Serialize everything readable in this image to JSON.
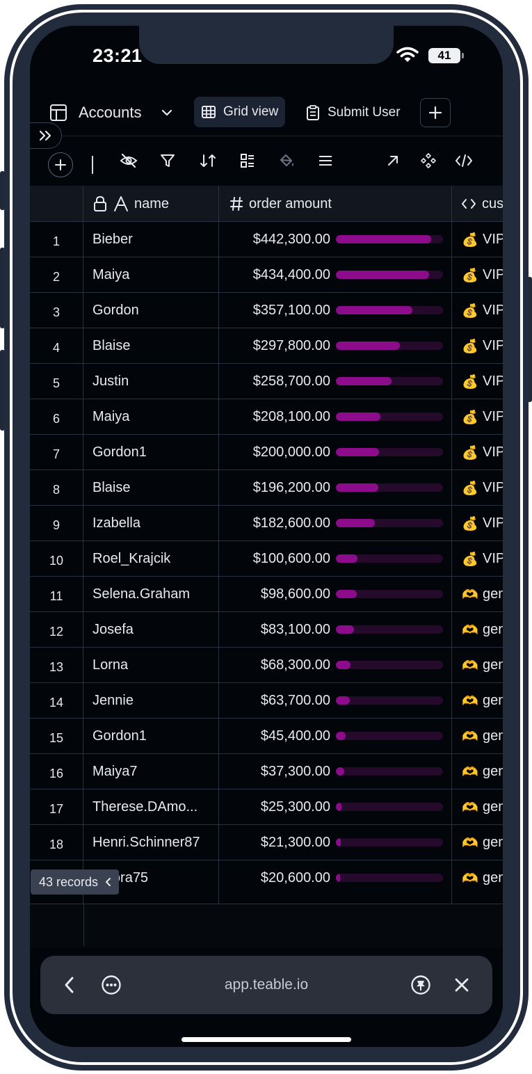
{
  "status_bar": {
    "time": "23:21",
    "battery": "41"
  },
  "topbar": {
    "table_name": "Accounts",
    "grid_view_label": "Grid view",
    "submit_view_label": "Submit User"
  },
  "icons": {
    "table": "table-icon",
    "chevron_down": "chevron-down-icon",
    "grid": "grid-view-icon",
    "form": "form-icon",
    "plus": "plus-icon",
    "expand": "double-chevron-right-icon",
    "hide_fields": "eye-off-icon",
    "filter": "filter-icon",
    "sort": "sort-icon",
    "group": "group-icon",
    "color": "paint-bucket-icon",
    "row_height": "lines-icon",
    "share": "arrow-up-right-icon",
    "extensions": "diamond-grid-icon",
    "api": "code-icon"
  },
  "columns": {
    "name": "name",
    "order_amount": "order amount",
    "customer_level": "cus"
  },
  "rows": [
    {
      "num": "1",
      "name": "Bieber",
      "amount": "$442,300.00",
      "fraction": 0.8875,
      "emoji": "💰",
      "level": "VIP"
    },
    {
      "num": "2",
      "name": "Maiya",
      "amount": "$434,400.00",
      "fraction": 0.872,
      "emoji": "💰",
      "level": "VIP"
    },
    {
      "num": "3",
      "name": "Gordon",
      "amount": "$357,100.00",
      "fraction": 0.717,
      "emoji": "💰",
      "level": "VIP"
    },
    {
      "num": "4",
      "name": "Blaise",
      "amount": "$297,800.00",
      "fraction": 0.598,
      "emoji": "💰",
      "level": "VIP"
    },
    {
      "num": "5",
      "name": "Justin",
      "amount": "$258,700.00",
      "fraction": 0.519,
      "emoji": "💰",
      "level": "VIP"
    },
    {
      "num": "6",
      "name": "Maiya",
      "amount": "$208,100.00",
      "fraction": 0.418,
      "emoji": "💰",
      "level": "VIP"
    },
    {
      "num": "7",
      "name": "Gordon1",
      "amount": "$200,000.00",
      "fraction": 0.401,
      "emoji": "💰",
      "level": "VIP"
    },
    {
      "num": "8",
      "name": "Blaise",
      "amount": "$196,200.00",
      "fraction": 0.394,
      "emoji": "💰",
      "level": "VIP"
    },
    {
      "num": "9",
      "name": "Izabella",
      "amount": "$182,600.00",
      "fraction": 0.366,
      "emoji": "💰",
      "level": "VIP"
    },
    {
      "num": "10",
      "name": "Roel_Krajcik",
      "amount": "$100,600.00",
      "fraction": 0.202,
      "emoji": "💰",
      "level": "VIP"
    },
    {
      "num": "11",
      "name": "Selena.Graham",
      "amount": "$98,600.00",
      "fraction": 0.198,
      "emoji": "🫶",
      "level": "general"
    },
    {
      "num": "12",
      "name": "Josefa",
      "amount": "$83,100.00",
      "fraction": 0.167,
      "emoji": "🫶",
      "level": "general"
    },
    {
      "num": "13",
      "name": "Lorna",
      "amount": "$68,300.00",
      "fraction": 0.137,
      "emoji": "🫶",
      "level": "general"
    },
    {
      "num": "14",
      "name": "Jennie",
      "amount": "$63,700.00",
      "fraction": 0.128,
      "emoji": "🫶",
      "level": "general"
    },
    {
      "num": "15",
      "name": "Gordon1",
      "amount": "$45,400.00",
      "fraction": 0.091,
      "emoji": "🫶",
      "level": "general"
    },
    {
      "num": "16",
      "name": "Maiya7",
      "amount": "$37,300.00",
      "fraction": 0.075,
      "emoji": "🫶",
      "level": "general"
    },
    {
      "num": "17",
      "name": "Therese.DAmo...",
      "amount": "$25,300.00",
      "fraction": 0.051,
      "emoji": "🫶",
      "level": "general"
    },
    {
      "num": "18",
      "name": "Henri.Schinner87",
      "amount": "$21,300.00",
      "fraction": 0.043,
      "emoji": "🫶",
      "level": "general"
    },
    {
      "num": "19",
      "name": "Elnora75",
      "amount": "$20,600.00",
      "fraction": 0.041,
      "emoji": "🫶",
      "level": "general"
    }
  ],
  "footer": {
    "records": "43 records"
  },
  "browser": {
    "url": "app.teable.io"
  },
  "colors": {
    "bar_fill": "#8c0c8c",
    "bar_track": "#250a2c",
    "background": "#020509"
  }
}
